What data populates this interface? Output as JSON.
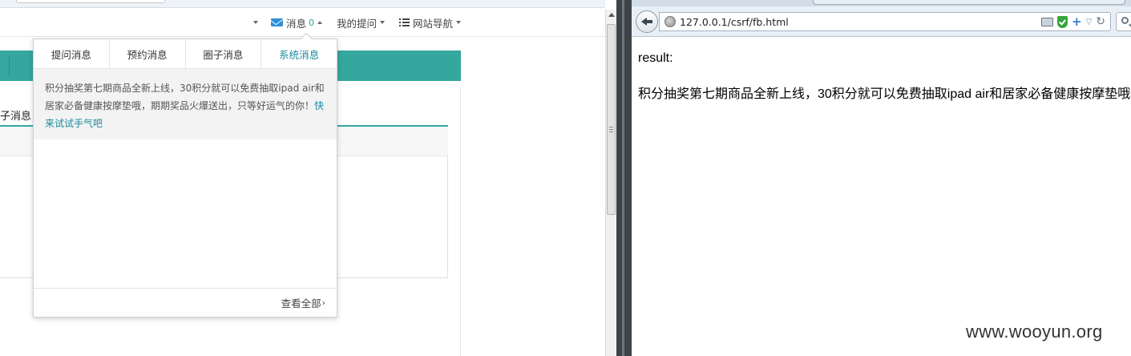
{
  "left": {
    "nav": {
      "messages_label": "消息",
      "messages_count": "0",
      "my_questions_label": "我的提问",
      "site_nav_label": "网站导航"
    },
    "tab_fragment": "子消息",
    "dropdown": {
      "tabs": [
        "提问消息",
        "预约消息",
        "圈子消息",
        "系统消息"
      ],
      "active_tab": "系统消息",
      "message_text": "积分抽奖第七期商品全新上线，30积分就可以免费抽取ipad air和居家必备健康按摩垫哦，期期奖品火爆送出，只等好运气的你！",
      "message_link": "快来试试手气吧",
      "view_all": "查看全部",
      "view_all_chevron": "›"
    }
  },
  "right": {
    "url": "127.0.0.1/csrf/fb.html",
    "result_label": "result:",
    "result_text": "积分抽奖第七期商品全新上线，30积分就可以免费抽取ipad air和居家必备健康按摩垫哦，期期奖品火爆送出，只等好运气的你！"
  },
  "watermark": "www.wooyun.org",
  "colors": {
    "teal": "#35a79f",
    "link_teal": "#1a8a9e",
    "envelope_blue": "#2f8fd8"
  },
  "icons": [
    "envelope-icon",
    "list-icon",
    "back-arrow-icon",
    "globe-icon",
    "monitor-icon",
    "shield-icon",
    "plus-icon",
    "reload-icon",
    "search-icon"
  ]
}
